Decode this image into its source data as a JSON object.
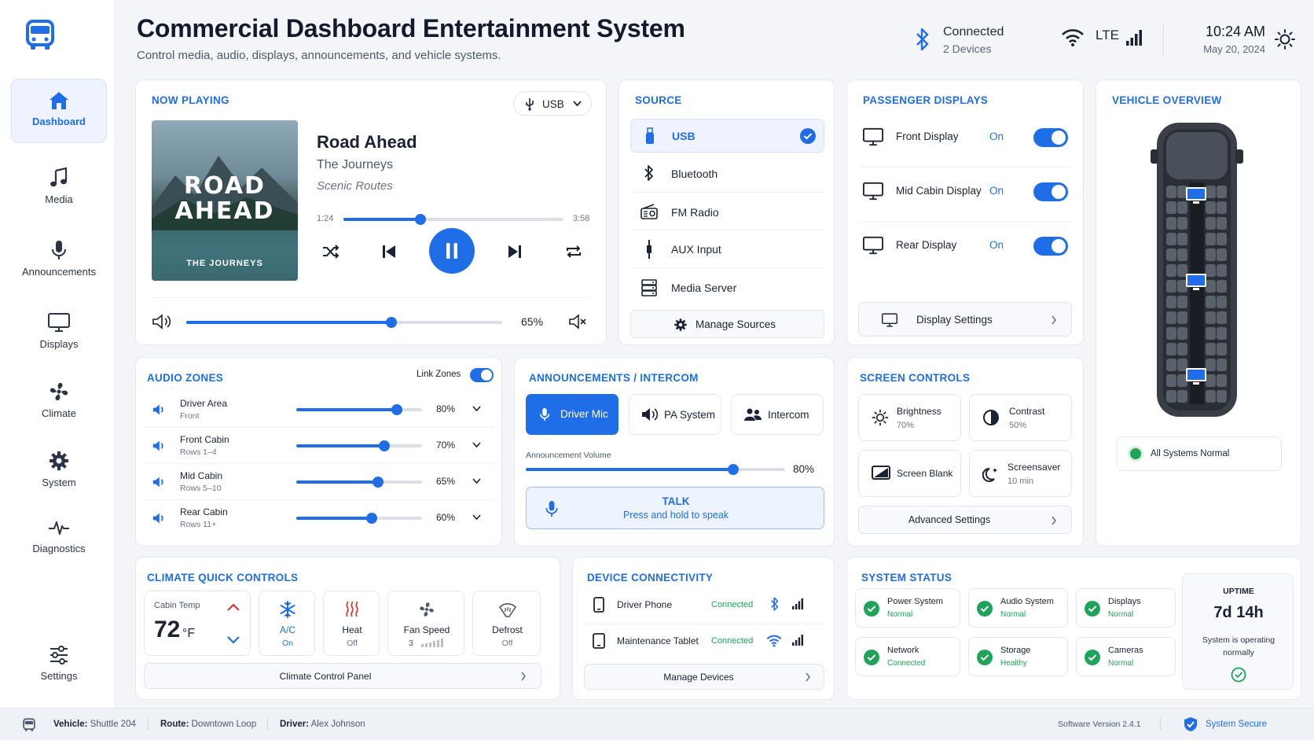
{
  "header": {
    "title": "Commercial Dashboard Entertainment System",
    "subtitle": "Control media, audio, displays, announcements, and vehicle systems.",
    "bluetooth_status": "Connected",
    "bluetooth_devices": "2 Devices",
    "network": "LTE",
    "time": "10:24 AM",
    "date": "May 20, 2024"
  },
  "sidebar": {
    "items": [
      {
        "label": "Dashboard",
        "icon": "home-icon"
      },
      {
        "label": "Media",
        "icon": "music-note-icon"
      },
      {
        "label": "Announcements",
        "icon": "microphone-icon"
      },
      {
        "label": "Displays",
        "icon": "monitor-icon"
      },
      {
        "label": "Climate",
        "icon": "fan-icon"
      },
      {
        "label": "System",
        "icon": "gear-icon"
      },
      {
        "label": "Diagnostics",
        "icon": "pulse-icon"
      },
      {
        "label": "Settings",
        "icon": "sliders-icon"
      }
    ]
  },
  "now_playing": {
    "title": "NOW PLAYING",
    "source_select": "USB",
    "album_art_line1": "ROAD",
    "album_art_line2": "AHEAD",
    "album_art_caption": "THE JOURNEYS",
    "track": "Road Ahead",
    "artist": "The Journeys",
    "album": "Scenic Routes",
    "elapsed": "1:24",
    "duration": "3:58",
    "progress": 0.35,
    "volume": 0.65,
    "volume_label": "65%"
  },
  "source": {
    "title": "SOURCE",
    "items": [
      {
        "label": "USB",
        "selected": true
      },
      {
        "label": "Bluetooth"
      },
      {
        "label": "FM Radio"
      },
      {
        "label": "AUX Input"
      },
      {
        "label": "Media Server"
      }
    ],
    "manage": "Manage Sources"
  },
  "passenger_displays": {
    "title": "PASSENGER DISPLAYS",
    "items": [
      {
        "label": "Front Display",
        "state": "On"
      },
      {
        "label": "Mid Cabin Display",
        "state": "On"
      },
      {
        "label": "Rear Display",
        "state": "On"
      }
    ],
    "settings": "Display Settings"
  },
  "vehicle_overview": {
    "title": "VEHICLE OVERVIEW",
    "status": "All Systems Normal"
  },
  "audio_zones": {
    "title": "AUDIO ZONES",
    "link_label": "Link Zones",
    "zones": [
      {
        "name": "Driver Area",
        "sub": "Front",
        "value": 0.8,
        "label": "80%"
      },
      {
        "name": "Front Cabin",
        "sub": "Rows 1–4",
        "value": 0.7,
        "label": "70%"
      },
      {
        "name": "Mid Cabin",
        "sub": "Rows 5–10",
        "value": 0.65,
        "label": "65%"
      },
      {
        "name": "Rear Cabin",
        "sub": "Rows 11+",
        "value": 0.6,
        "label": "60%"
      }
    ]
  },
  "announcements": {
    "title": "ANNOUNCEMENTS / INTERCOM",
    "modes": [
      "Driver Mic",
      "PA System",
      "Intercom"
    ],
    "volume_label": "Announcement Volume",
    "volume": 0.8,
    "volume_text": "80%",
    "talk": "TALK",
    "talk_hint": "Press and hold to speak"
  },
  "screen_controls": {
    "title": "SCREEN CONTROLS",
    "brightness": "Brightness",
    "brightness_val": "70%",
    "contrast": "Contrast",
    "contrast_val": "50%",
    "blank": "Screen Blank",
    "saver": "Screensaver",
    "saver_val": "10 min",
    "advanced": "Advanced Settings"
  },
  "climate": {
    "title": "CLIMATE QUICK CONTROLS",
    "temp_label": "Cabin Temp",
    "temp": "72",
    "unit": "°F",
    "tiles": [
      {
        "label": "A/C",
        "state": "On"
      },
      {
        "label": "Heat",
        "state": "Off"
      },
      {
        "label": "Fan Speed",
        "state": "3"
      },
      {
        "label": "Defrost",
        "state": "Off"
      }
    ],
    "panel": "Climate Control Panel"
  },
  "devices": {
    "title": "DEVICE CONNECTIVITY",
    "items": [
      {
        "name": "Driver Phone",
        "status": "Connected"
      },
      {
        "name": "Maintenance Tablet",
        "status": "Connected"
      }
    ],
    "manage": "Manage Devices"
  },
  "system_status": {
    "title": "SYSTEM STATUS",
    "items": [
      {
        "name": "Power System",
        "state": "Normal"
      },
      {
        "name": "Audio System",
        "state": "Normal"
      },
      {
        "name": "Displays",
        "state": "Normal"
      },
      {
        "name": "Network",
        "state": "Connected"
      },
      {
        "name": "Storage",
        "state": "Healthy"
      },
      {
        "name": "Cameras",
        "state": "Normal"
      }
    ],
    "uptime_label": "UPTIME",
    "uptime": "7d 14h",
    "uptime_note": "System is operating normally"
  },
  "footer": {
    "vehicle_label": "Vehicle:",
    "vehicle": "Shuttle 204",
    "route_label": "Route:",
    "route": "Downtown Loop",
    "driver_label": "Driver:",
    "driver": "Alex Johnson",
    "version": "Software Version 2.4.1",
    "secure": "System Secure"
  },
  "colors": {
    "accent": "#1f6ee8",
    "success": "#1fa35a"
  }
}
